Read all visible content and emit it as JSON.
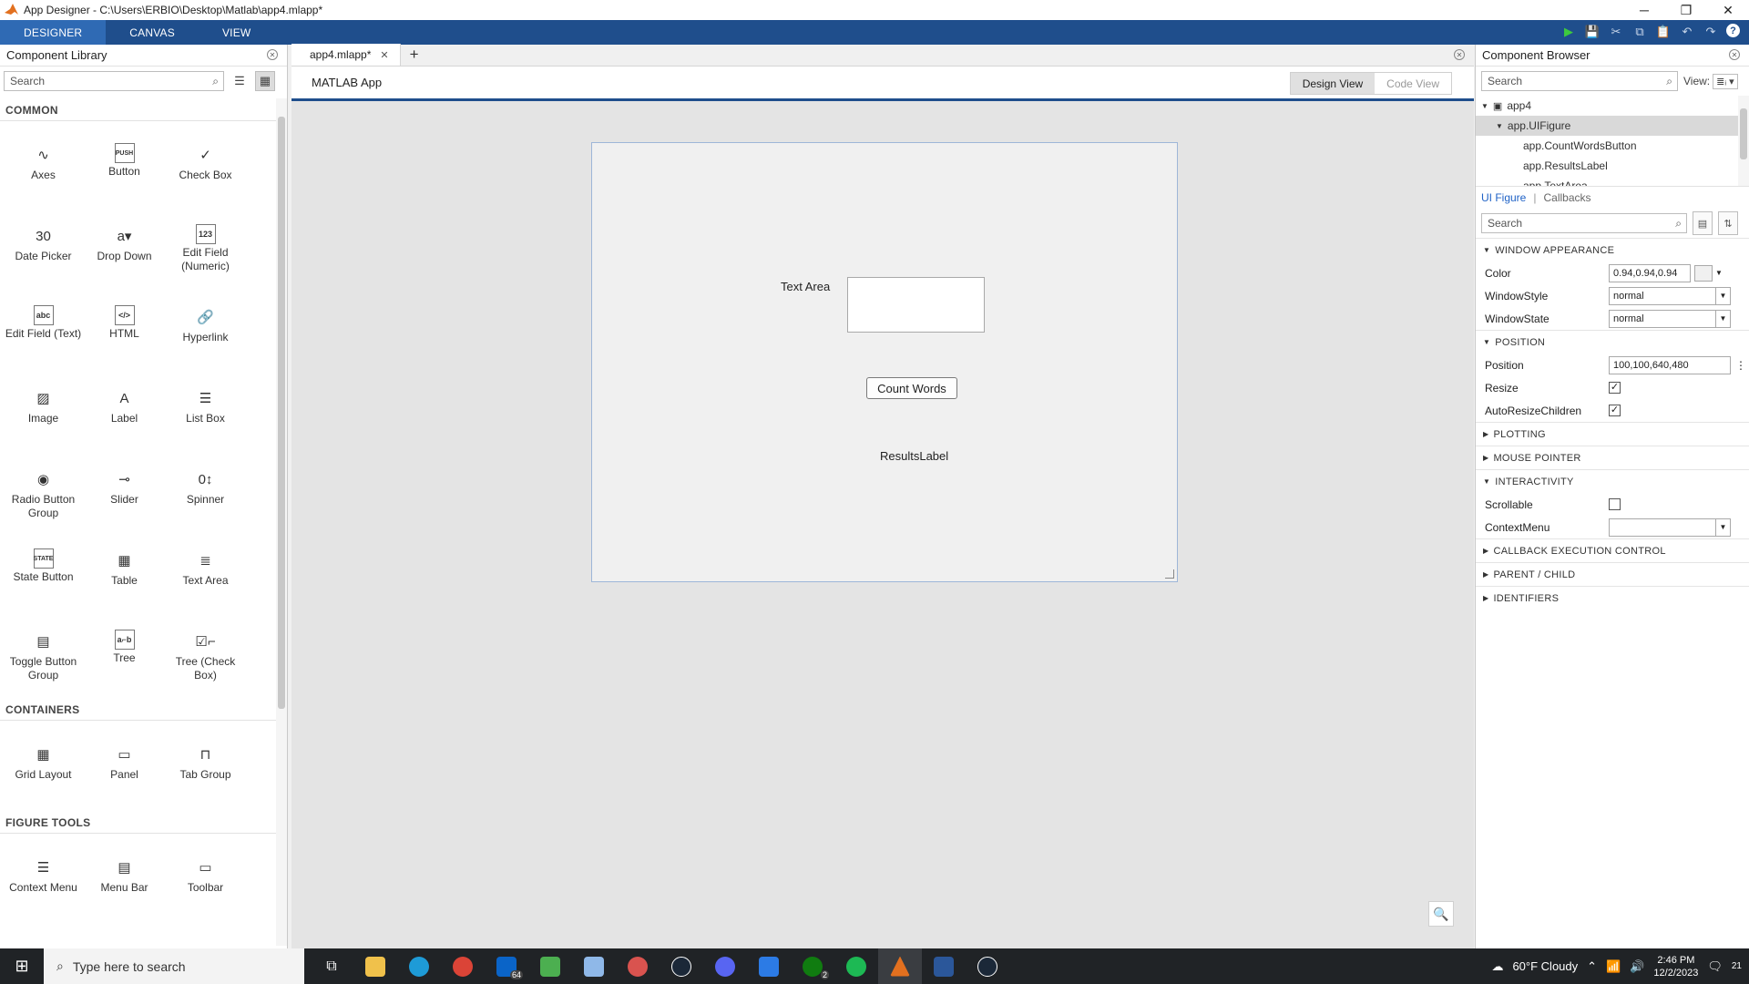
{
  "window": {
    "title": "App Designer - C:\\Users\\ERBIO\\Desktop\\Matlab\\app4.mlapp*"
  },
  "ribbon": {
    "tabs": [
      "DESIGNER",
      "CANVAS",
      "VIEW"
    ],
    "active": "DESIGNER"
  },
  "library": {
    "title": "Component Library",
    "search_placeholder": "Search",
    "sections": [
      {
        "name": "COMMON",
        "items": [
          {
            "label": "Axes",
            "icon": "axes-icon",
            "glyph": "∿"
          },
          {
            "label": "Button",
            "icon": "button-icon",
            "glyph": "PUSH"
          },
          {
            "label": "Check Box",
            "icon": "checkbox-icon",
            "glyph": "✓"
          },
          {
            "label": "Date Picker",
            "icon": "date-picker-icon",
            "glyph": "30"
          },
          {
            "label": "Drop Down",
            "icon": "dropdown-icon",
            "glyph": "a▾"
          },
          {
            "label": "Edit Field (Numeric)",
            "icon": "numeric-field-icon",
            "glyph": "123"
          },
          {
            "label": "Edit Field (Text)",
            "icon": "text-field-icon",
            "glyph": "abc"
          },
          {
            "label": "HTML",
            "icon": "html-icon",
            "glyph": "</>"
          },
          {
            "label": "Hyperlink",
            "icon": "hyperlink-icon",
            "glyph": "🔗"
          },
          {
            "label": "Image",
            "icon": "image-icon",
            "glyph": "▨"
          },
          {
            "label": "Label",
            "icon": "label-icon",
            "glyph": "A"
          },
          {
            "label": "List Box",
            "icon": "listbox-icon",
            "glyph": "☰"
          },
          {
            "label": "Radio Button Group",
            "icon": "radio-group-icon",
            "glyph": "◉"
          },
          {
            "label": "Slider",
            "icon": "slider-icon",
            "glyph": "⊸"
          },
          {
            "label": "Spinner",
            "icon": "spinner-icon",
            "glyph": "0↕"
          },
          {
            "label": "State Button",
            "icon": "state-button-icon",
            "glyph": "STATE"
          },
          {
            "label": "Table",
            "icon": "table-icon",
            "glyph": "▦"
          },
          {
            "label": "Text Area",
            "icon": "text-area-icon",
            "glyph": "≣"
          },
          {
            "label": "Toggle Button Group",
            "icon": "toggle-group-icon",
            "glyph": "▤"
          },
          {
            "label": "Tree",
            "icon": "tree-icon",
            "glyph": "a⌐b"
          },
          {
            "label": "Tree (Check Box)",
            "icon": "tree-checkbox-icon",
            "glyph": "☑⌐"
          }
        ]
      },
      {
        "name": "CONTAINERS",
        "items": [
          {
            "label": "Grid Layout",
            "icon": "grid-layout-icon",
            "glyph": "▦"
          },
          {
            "label": "Panel",
            "icon": "panel-icon",
            "glyph": "▭"
          },
          {
            "label": "Tab Group",
            "icon": "tab-group-icon",
            "glyph": "⊓"
          }
        ]
      },
      {
        "name": "FIGURE TOOLS",
        "items": [
          {
            "label": "Context Menu",
            "icon": "context-menu-icon",
            "glyph": "☰"
          },
          {
            "label": "Menu Bar",
            "icon": "menu-bar-icon",
            "glyph": "▤"
          },
          {
            "label": "Toolbar",
            "icon": "toolbar-icon",
            "glyph": "▭"
          }
        ]
      }
    ]
  },
  "document": {
    "tab": "app4.mlapp*",
    "app_title": "MATLAB App",
    "view_toggle": {
      "design": "Design View",
      "code": "Code View",
      "active": "Design View"
    }
  },
  "figure": {
    "text_area_label": "Text Area",
    "button_label": "Count Words",
    "results_label": "ResultsLabel"
  },
  "browser": {
    "title": "Component Browser",
    "search_placeholder": "Search",
    "view_label": "View:",
    "tree": [
      {
        "label": "app4",
        "level": 0
      },
      {
        "label": "app.UIFigure",
        "level": 1,
        "selected": true
      },
      {
        "label": "app.CountWordsButton",
        "level": 2
      },
      {
        "label": "app.ResultsLabel",
        "level": 2
      },
      {
        "label": "app.TextArea",
        "level": 2
      }
    ]
  },
  "inspector": {
    "tab1": "UI Figure",
    "tab2": "Callbacks",
    "search_placeholder": "Search",
    "window_appearance": "WINDOW APPEARANCE",
    "color_label": "Color",
    "color_value": "0.94,0.94,0.94",
    "windowstyle_label": "WindowStyle",
    "windowstyle_value": "normal",
    "windowstate_label": "WindowState",
    "windowstate_value": "normal",
    "position_group": "POSITION",
    "position_label": "Position",
    "position_value": "100,100,640,480",
    "resize_label": "Resize",
    "resize_checked": true,
    "autoresize_label": "AutoResizeChildren",
    "autoresize_checked": true,
    "plotting": "PLOTTING",
    "mouse_pointer": "MOUSE POINTER",
    "interactivity": "INTERACTIVITY",
    "scrollable_label": "Scrollable",
    "scrollable_checked": false,
    "contextmenu_label": "ContextMenu",
    "contextmenu_value": "",
    "callback_exec": "CALLBACK EXECUTION CONTROL",
    "parent_child": "PARENT / CHILD",
    "identifiers": "IDENTIFIERS"
  },
  "taskbar": {
    "search_placeholder": "Type here to search",
    "weather": "60°F  Cloudy",
    "time": "2:46 PM",
    "date": "12/2/2023",
    "notifications": "21",
    "mail_badge": "64",
    "xbox_badge": "2"
  },
  "colors": {
    "ribbon": "#1f4e8c",
    "accent": "#1f62c6"
  }
}
